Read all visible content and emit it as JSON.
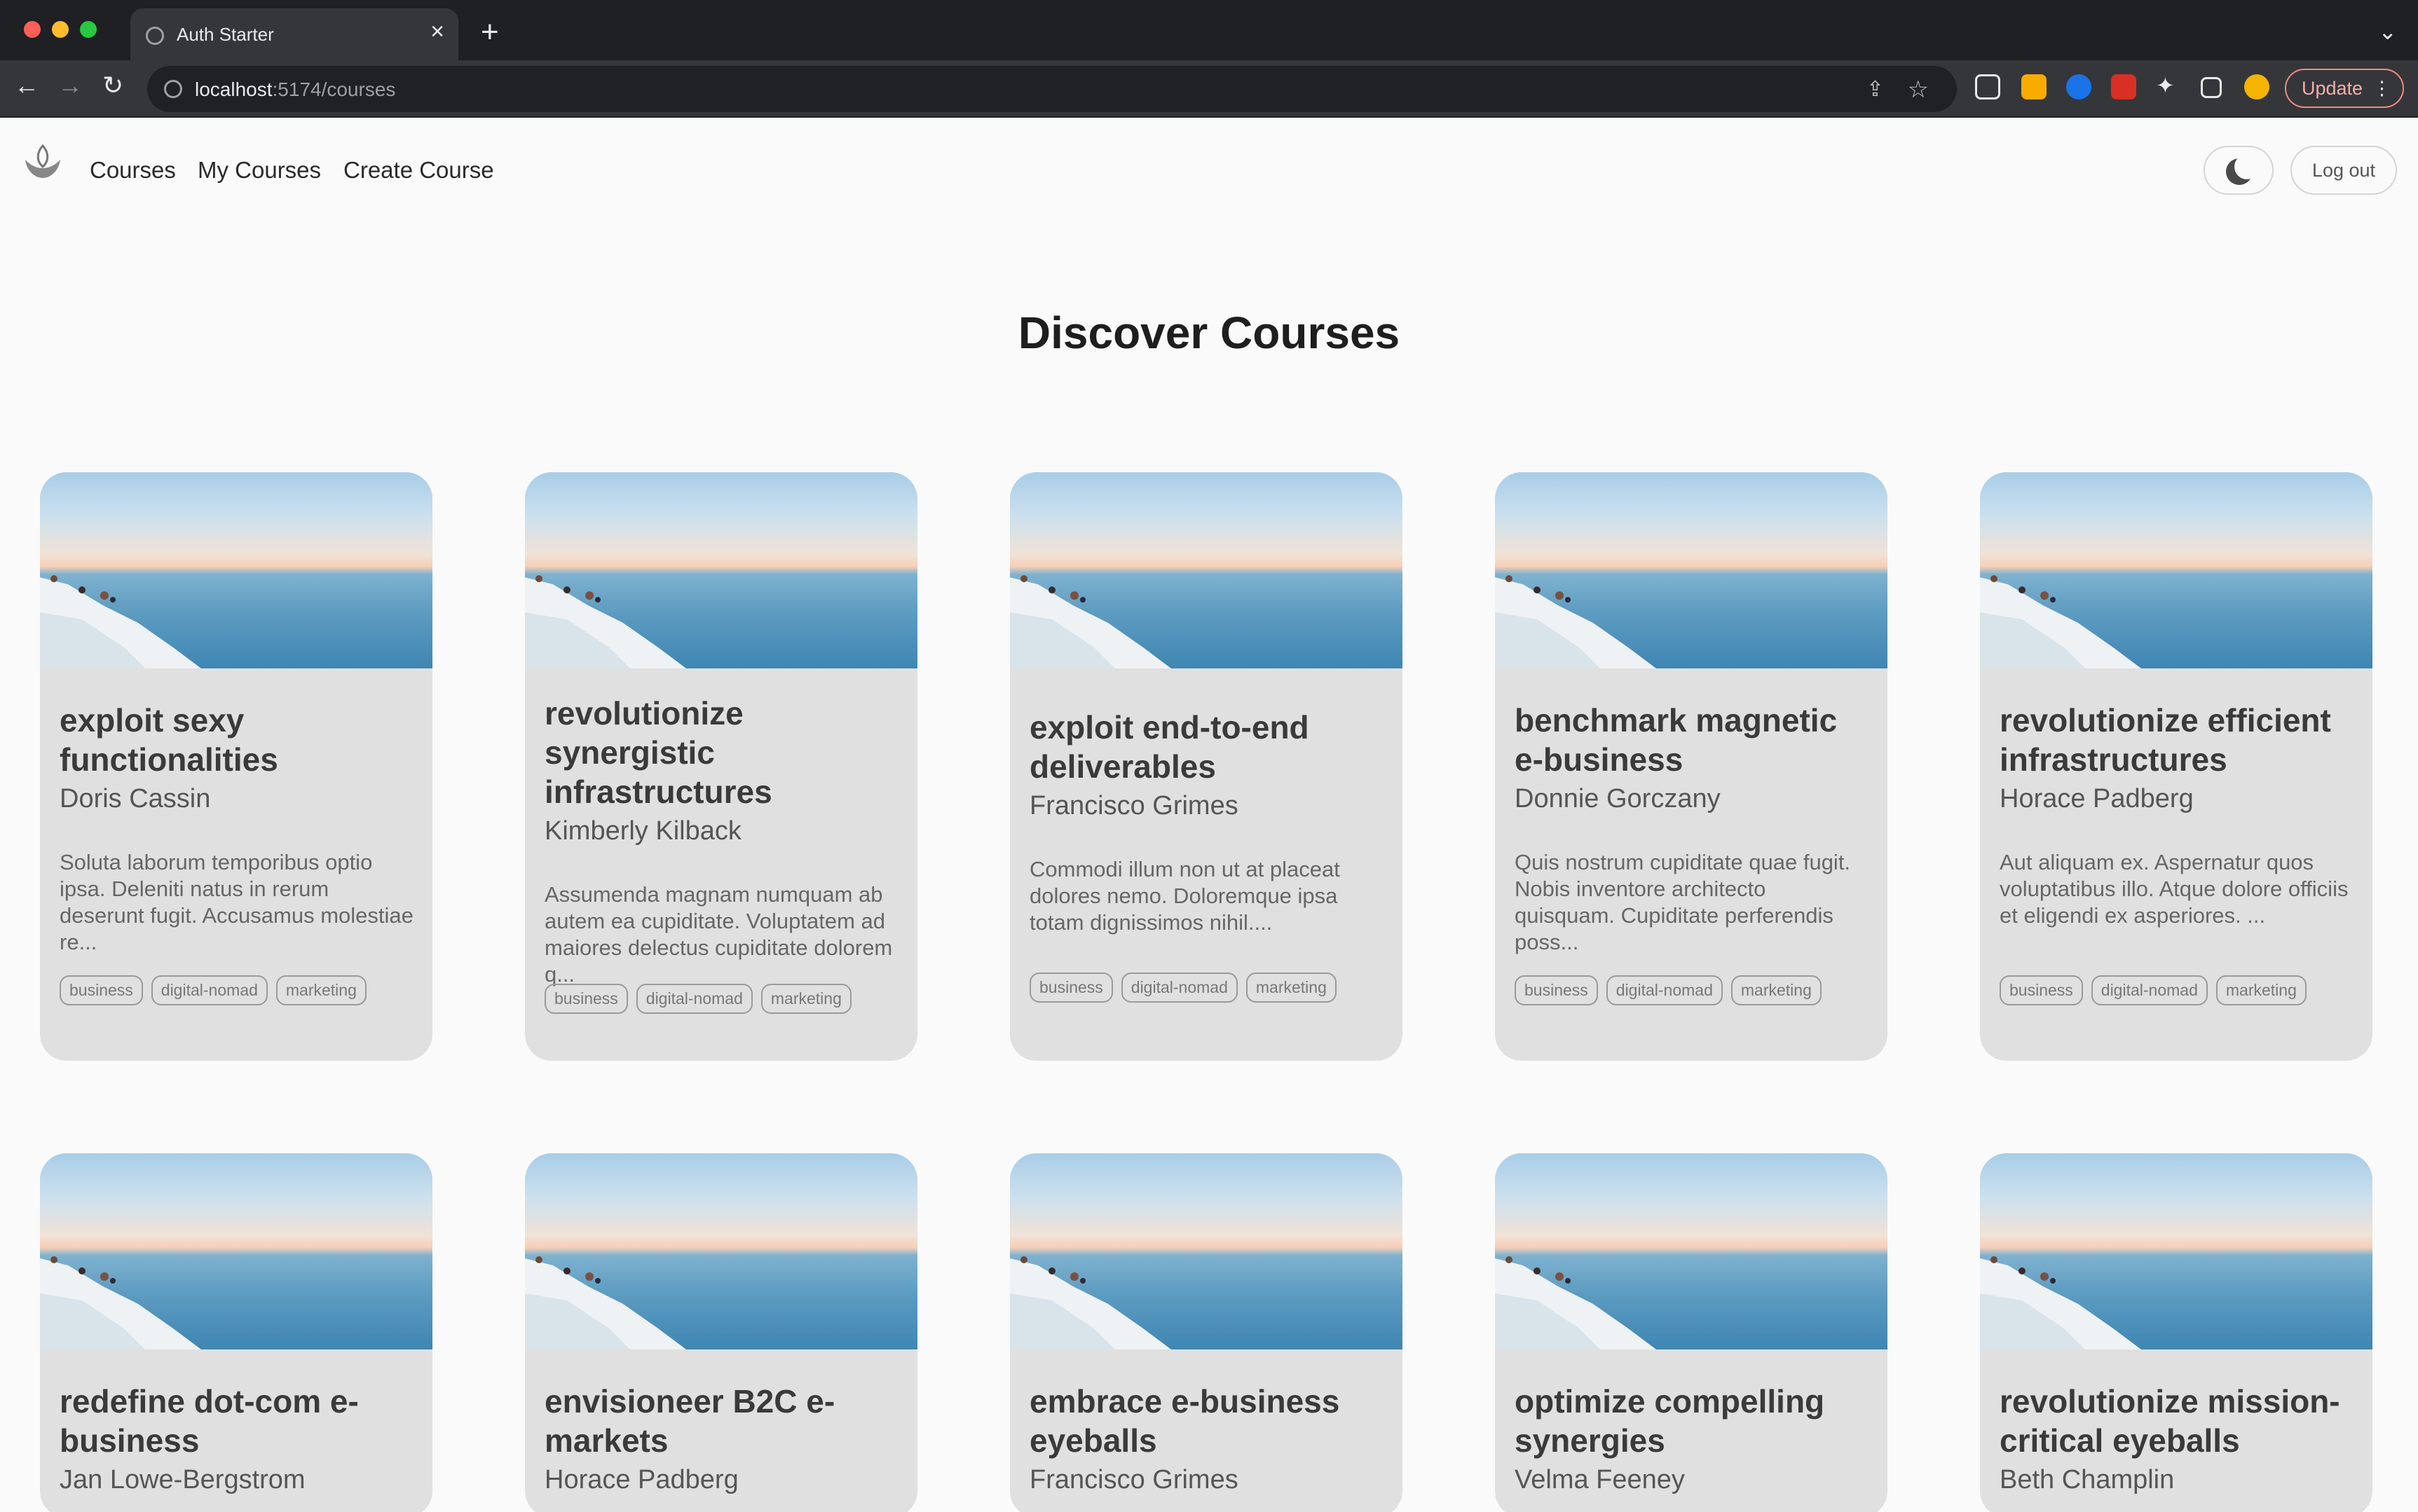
{
  "browser": {
    "tab_title": "Auth Starter",
    "new_tab": "+",
    "url_host": "localhost",
    "url_path": ":5174/courses",
    "update_label": "Update",
    "icons": [
      "globe-icon",
      "close-icon",
      "back-icon",
      "forward-icon",
      "reload-icon",
      "info-icon",
      "share-icon",
      "star-icon",
      "puzzle-icon",
      "sidebar-icon",
      "kebab-icon"
    ]
  },
  "header": {
    "nav": [
      "Courses",
      "My Courses",
      "Create Course"
    ],
    "logout_label": "Log out",
    "theme_icon": "moon-icon"
  },
  "page_title": "Discover Courses",
  "courses": [
    {
      "title": "exploit sexy functionalities",
      "author": "Doris Cassin",
      "description": "Soluta laborum temporibus optio ipsa. Deleniti natus in rerum deserunt fugit. Accusamus molestiae re...",
      "tags": [
        "business",
        "digital-nomad",
        "marketing"
      ]
    },
    {
      "title": "revolutionize synergistic infrastructures",
      "author": "Kimberly Kilback",
      "description": "Assumenda magnam numquam ab autem ea cupiditate. Voluptatem ad maiores delectus cupiditate dolorem q...",
      "tags": [
        "business",
        "digital-nomad",
        "marketing"
      ]
    },
    {
      "title": "exploit end-to-end deliverables",
      "author": "Francisco Grimes",
      "description": "Commodi illum non ut at placeat dolores nemo. Doloremque ipsa totam dignissimos nihil....",
      "tags": [
        "business",
        "digital-nomad",
        "marketing"
      ]
    },
    {
      "title": "benchmark magnetic e-business",
      "author": "Donnie Gorczany",
      "description": "Quis nostrum cupiditate quae fugit. Nobis inventore architecto quisquam. Cupiditate perferendis poss...",
      "tags": [
        "business",
        "digital-nomad",
        "marketing"
      ]
    },
    {
      "title": "revolutionize efficient infrastructures",
      "author": "Horace Padberg",
      "description": "Aut aliquam ex. Aspernatur quos voluptatibus illo. Atque dolore officiis et eligendi ex asperiores. ...",
      "tags": [
        "business",
        "digital-nomad",
        "marketing"
      ]
    },
    {
      "title": "redefine dot-com e-business",
      "author": "Jan Lowe-Bergstrom",
      "description": "",
      "tags": []
    },
    {
      "title": "envisioneer B2C e-markets",
      "author": "Horace Padberg",
      "description": "",
      "tags": []
    },
    {
      "title": "embrace e-business eyeballs",
      "author": "Francisco Grimes",
      "description": "",
      "tags": []
    },
    {
      "title": "optimize compelling synergies",
      "author": "Velma Feeney",
      "description": "",
      "tags": []
    },
    {
      "title": "revolutionize mission-critical eyeballs",
      "author": "Beth Champlin",
      "description": "",
      "tags": []
    }
  ]
}
